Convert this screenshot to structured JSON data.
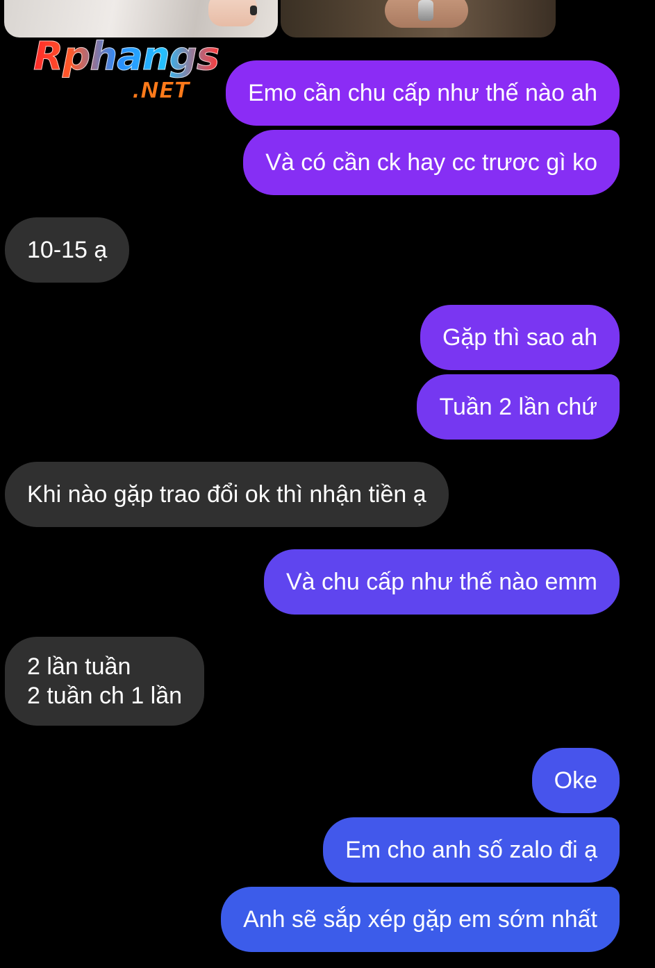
{
  "watermark": {
    "brand": "Rphangs",
    "suffix": ".NET"
  },
  "photos": [
    {
      "name": "photo-left"
    },
    {
      "name": "photo-right"
    }
  ],
  "messages": [
    {
      "direction": "outgoing",
      "text": "Emo cần chu cấp như thế nào ah",
      "color": "#8b2cf5"
    },
    {
      "direction": "outgoing",
      "text": "Và có cần ck hay cc trươc gì ko",
      "color": "#862ff4"
    },
    {
      "direction": "incoming",
      "text": "10-15 ạ",
      "color": "#303030"
    },
    {
      "direction": "outgoing",
      "text": "Gặp thì sao ah",
      "color": "#7a36f2"
    },
    {
      "direction": "outgoing",
      "text": "Tuần 2 lần chứ",
      "color": "#7538f1"
    },
    {
      "direction": "incoming",
      "text": "Khi nào gặp trao đổi ok thì nhận tiền ạ",
      "color": "#303030"
    },
    {
      "direction": "outgoing",
      "text": "Và chu cấp như thế nào emm",
      "color": "#5f45ef"
    },
    {
      "direction": "incoming",
      "lines": [
        "2 lần tuần",
        "2 tuần ch 1 lần"
      ],
      "color": "#303030"
    },
    {
      "direction": "outgoing",
      "text": "Oke",
      "color": "#4754ec"
    },
    {
      "direction": "outgoing",
      "text": "Em cho anh số zalo đi ạ",
      "color": "#4258eb"
    },
    {
      "direction": "outgoing",
      "text": "Anh sẽ sắp xép gặp em sớm nhất",
      "color": "#3c5cea"
    }
  ]
}
